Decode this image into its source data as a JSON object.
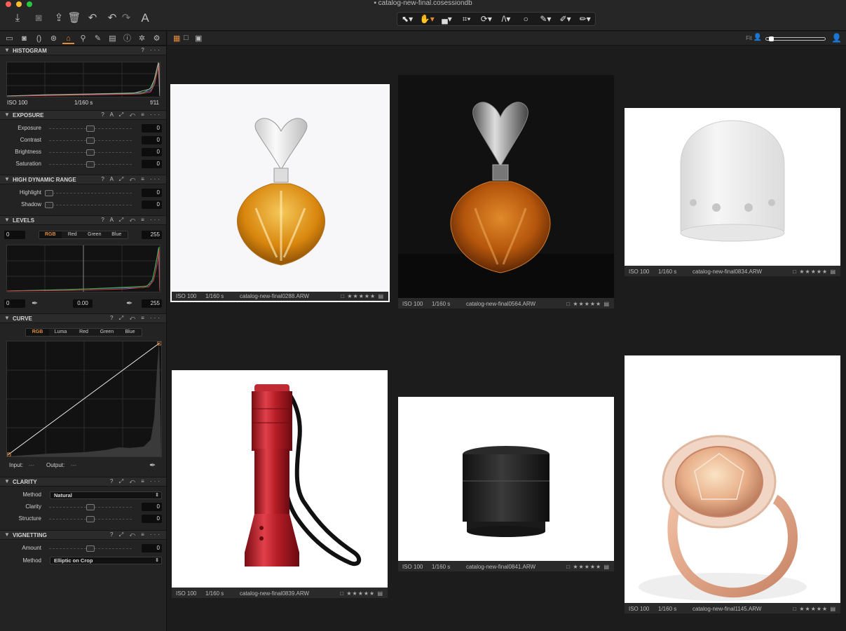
{
  "window": {
    "title": "catalog-new-final.cosessiondb"
  },
  "colors": {
    "accent": "#e08a3a",
    "panel_bg": "#232323",
    "viewer_bg": "#1c1c1c"
  },
  "toolbar_icons": [
    "import-icon",
    "camera-icon",
    "export-icon",
    "trash-icon",
    "undo-icon",
    "redo-icon",
    "text-icon"
  ],
  "cursor_tools": [
    "select-tool",
    "pan-tool",
    "loupe-tool",
    "crop-tool",
    "rotate-tool",
    "keystone-tool",
    "spot-tool",
    "brush-tool",
    "picker-tool",
    "annotate-tool"
  ],
  "histogram": {
    "title": "HISTOGRAM",
    "iso": "ISO 100",
    "shutter": "1/160 s",
    "aperture": "f/11"
  },
  "exposure": {
    "title": "EXPOSURE",
    "rows": [
      {
        "label": "Exposure",
        "value": "0"
      },
      {
        "label": "Contrast",
        "value": "0"
      },
      {
        "label": "Brightness",
        "value": "0"
      },
      {
        "label": "Saturation",
        "value": "0"
      }
    ]
  },
  "hdr": {
    "title": "HIGH DYNAMIC RANGE",
    "rows": [
      {
        "label": "Highlight",
        "value": "0"
      },
      {
        "label": "Shadow",
        "value": "0"
      }
    ]
  },
  "levels": {
    "title": "LEVELS",
    "left": "0",
    "right": "255",
    "channels": [
      "RGB",
      "Red",
      "Green",
      "Blue"
    ],
    "bottom_left": "0",
    "mid": "0.00",
    "bottom_right": "255"
  },
  "curve": {
    "title": "CURVE",
    "channels": [
      "RGB",
      "Luma",
      "Red",
      "Green",
      "Blue"
    ],
    "input_label": "Input:",
    "input_val": "---",
    "output_label": "Output:",
    "output_val": "---"
  },
  "clarity": {
    "title": "CLARITY",
    "method_label": "Method",
    "method_value": "Natural",
    "rows": [
      {
        "label": "Clarity",
        "value": "0"
      },
      {
        "label": "Structure",
        "value": "0"
      }
    ]
  },
  "vignetting": {
    "title": "VIGNETTING",
    "amount_label": "Amount",
    "amount_value": "0",
    "method_label": "Method",
    "method_value": "Elliptic on Crop"
  },
  "viewer": {
    "fit_label": "Fit"
  },
  "thumbs": [
    {
      "iso": "ISO 100",
      "shutter": "1/160 s",
      "file": "catalog-new-final0288.ARW",
      "stars": "★★★★★"
    },
    {
      "iso": "ISO 100",
      "shutter": "1/160 s",
      "file": "catalog-new-final0564.ARW",
      "stars": "★★★★★"
    },
    {
      "iso": "ISO 100",
      "shutter": "1/160 s",
      "file": "catalog-new-final0834.ARW",
      "stars": "★★★★★"
    },
    {
      "iso": "ISO 100",
      "shutter": "1/160 s",
      "file": "catalog-new-final0839.ARW",
      "stars": "★★★★★"
    },
    {
      "iso": "ISO 100",
      "shutter": "1/160 s",
      "file": "catalog-new-final0841.ARW",
      "stars": "★★★★★"
    },
    {
      "iso": "ISO 100",
      "shutter": "1/160 s",
      "file": "catalog-new-final1145.ARW",
      "stars": "★★★★★"
    }
  ]
}
